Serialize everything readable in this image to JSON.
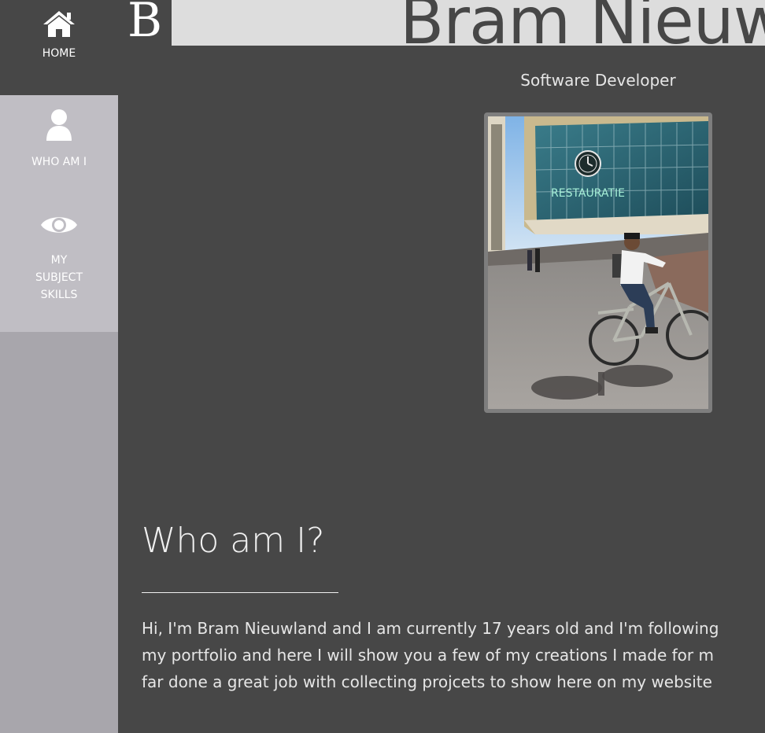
{
  "header": {
    "logo": "B",
    "title": "Bram Nieuwland",
    "subtitle": "Software Developer"
  },
  "nav": {
    "home": {
      "icon": "home-icon",
      "label": "HOME"
    },
    "who": {
      "icon": "user-icon",
      "label": "WHO AM I"
    },
    "skills": {
      "icon": "eye-icon",
      "label_lines": [
        "MY",
        "SUBJECT",
        "SKILLS"
      ]
    }
  },
  "about": {
    "heading": "Who am I?",
    "lines": [
      "Hi, I'm Bram Nieuwland and I am currently 17 years old and I'm following",
      "my portfolio and here I will show you a few of my creations I made for m",
      "far done a great job with collecting projcets to show here on my website"
    ]
  },
  "colors": {
    "background": "#474747",
    "sidebar": "#a8a6ac",
    "sidebar_item": "#c0bec4",
    "header_bar": "#dddddd"
  }
}
